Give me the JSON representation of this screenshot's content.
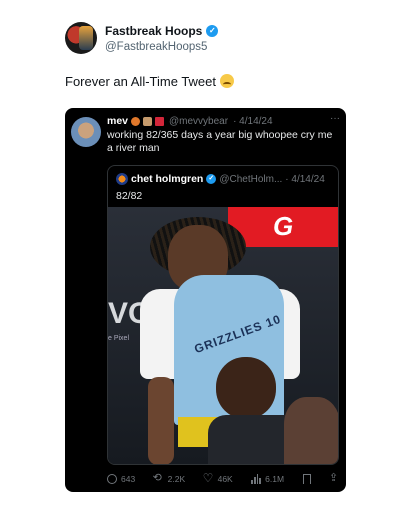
{
  "author": {
    "display_name": "Fastbreak Hoops",
    "handle": "@FastbreakHoops5",
    "avatar_icon": "team-logo-avatar",
    "verified_icon": "verified-badge-icon"
  },
  "tweet": {
    "text": "Forever an All-Time Tweet",
    "emoji": "crying-face-emoji"
  },
  "embedded_tweet": {
    "display_name": "mev",
    "handle": "@mevvybear",
    "date": "· 4/14/24",
    "more": "···",
    "text": "working 82/365 days a year big whoopee cry me a river man",
    "quoted": {
      "display_name": "chet holmgren",
      "handle": "@ChetHolm...",
      "date": "· 4/14/24",
      "text": "82/82"
    },
    "photo": {
      "brand_sign": "G",
      "wall_text": "VOF",
      "wall_sub": "e Pixel",
      "jersey_text": "GRIZZLIES 10"
    },
    "actions": {
      "replies": "643",
      "reposts": "2.2K",
      "likes": "46K",
      "views": "6.1M"
    }
  },
  "colors": {
    "accent": "#1d9bf0",
    "card_bg": "#000000",
    "muted": "#71767b"
  }
}
